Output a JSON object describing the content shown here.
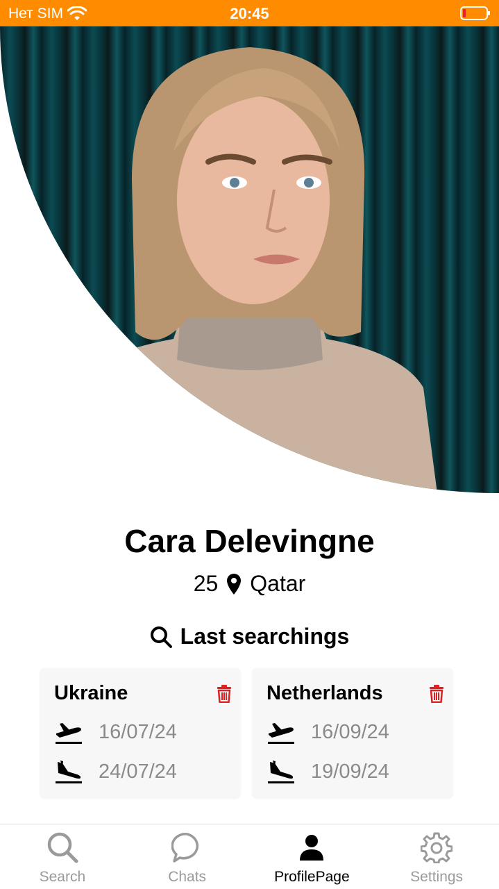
{
  "status_bar": {
    "carrier": "Нет SIM",
    "time": "20:45",
    "wifi_icon": "wifi-icon",
    "battery_icon": "battery-low-icon"
  },
  "profile": {
    "photo_description_icon": "profile-photo",
    "name": "Cara Delevingne",
    "age": "25",
    "location": "Qatar"
  },
  "searches": {
    "title": "Last searchings",
    "items": [
      {
        "destination": "Ukraine",
        "departure": "16/07/24",
        "arrival": "24/07/24"
      },
      {
        "destination": "Netherlands",
        "departure": "16/09/24",
        "arrival": "19/09/24"
      }
    ]
  },
  "tab_bar": {
    "tabs": [
      {
        "label": "Search",
        "icon": "search-icon"
      },
      {
        "label": "Chats",
        "icon": "chat-bubble-icon"
      },
      {
        "label": "ProfilePage",
        "icon": "person-icon",
        "active": true
      },
      {
        "label": "Settings",
        "icon": "gear-icon"
      }
    ]
  },
  "colors": {
    "status_bar": "#ff8c00",
    "delete": "#e02020",
    "inactive_tab": "#9a9a9a"
  }
}
